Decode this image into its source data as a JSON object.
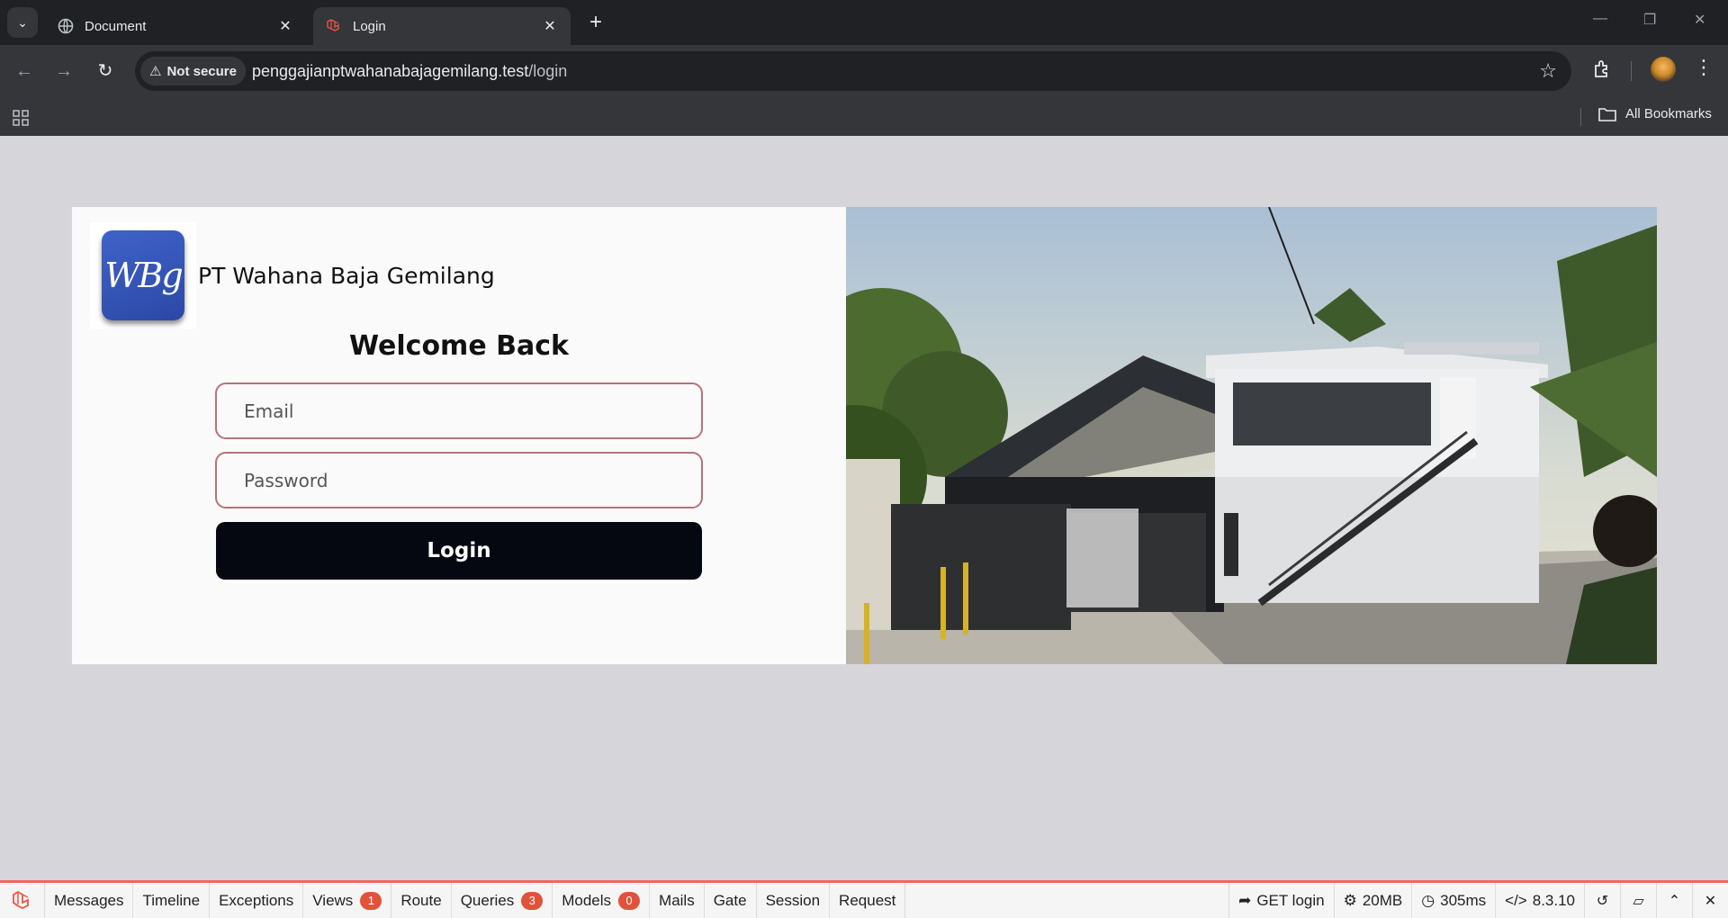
{
  "browser": {
    "tabs": [
      {
        "title": "Document",
        "active": false
      },
      {
        "title": "Login",
        "active": true
      }
    ],
    "security_chip": "Not secure",
    "url_host": "penggajianptwahanabajagemilang.test",
    "url_path": "/login",
    "bookmarks_label": "All Bookmarks"
  },
  "page": {
    "logo_text": "WBg",
    "company_name": "PT Wahana Baja Gemilang",
    "heading": "Welcome Back",
    "email_placeholder": "Email",
    "password_placeholder": "Password",
    "login_label": "Login"
  },
  "debugbar": {
    "tabs": [
      {
        "label": "Messages"
      },
      {
        "label": "Timeline"
      },
      {
        "label": "Exceptions"
      },
      {
        "label": "Views",
        "badge": "1"
      },
      {
        "label": "Route"
      },
      {
        "label": "Queries",
        "badge": "3"
      },
      {
        "label": "Models",
        "badge": "0"
      },
      {
        "label": "Mails"
      },
      {
        "label": "Gate"
      },
      {
        "label": "Session"
      },
      {
        "label": "Request"
      }
    ],
    "request": "GET login",
    "memory": "20MB",
    "duration": "305ms",
    "php_version": "8.3.10"
  },
  "colors": {
    "accent": "#f4645f",
    "login_button": "#050711",
    "field_border": "#b5737a",
    "logo_blue": "#2c48a6"
  }
}
